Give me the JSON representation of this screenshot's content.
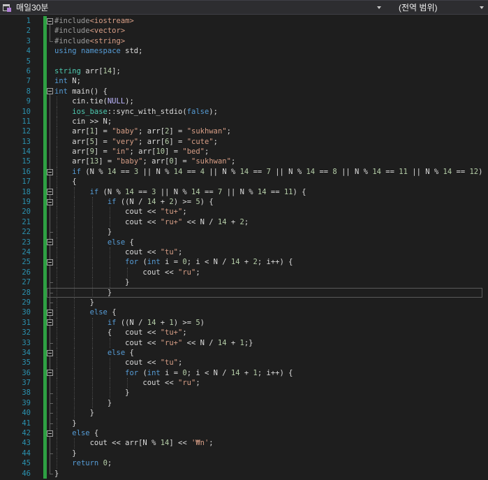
{
  "navbar": {
    "project": "매일30분",
    "scope": "(전역 범위)"
  },
  "colors": {
    "background": "#1E1E1E",
    "navbar_background": "#2D2D30",
    "line_number": "#2B91AF",
    "keyword": "#569CD6",
    "string": "#D69D85",
    "number": "#B5CEA8",
    "type": "#4EC9B0",
    "preprocessor": "#9B9B9B",
    "macro": "#BEB7FF",
    "plain_text": "#DCDCDC",
    "change_tracking": "#2EA043"
  },
  "code": {
    "language": "cpp",
    "current_line": 28,
    "lines": [
      {
        "n": 1,
        "m": "b",
        "g": [],
        "t": [
          [
            "pp",
            "#include"
          ],
          [
            "str",
            "<iostream>"
          ]
        ]
      },
      {
        "n": 2,
        "m": "l",
        "g": [],
        "t": [
          [
            "pp",
            "#include"
          ],
          [
            "str",
            "<vector>"
          ]
        ]
      },
      {
        "n": 3,
        "m": "c",
        "g": [],
        "t": [
          [
            "pp",
            "#include"
          ],
          [
            "str",
            "<string>"
          ]
        ]
      },
      {
        "n": 4,
        "m": "",
        "g": [],
        "t": [
          [
            "kw",
            "using"
          ],
          [
            "pl",
            " "
          ],
          [
            "kw",
            "namespace"
          ],
          [
            "pl",
            " std;"
          ]
        ]
      },
      {
        "n": 5,
        "m": "",
        "g": [],
        "t": []
      },
      {
        "n": 6,
        "m": "",
        "g": [],
        "t": [
          [
            "ty",
            "string"
          ],
          [
            "pl",
            " arr["
          ],
          [
            "num",
            "14"
          ],
          [
            "pl",
            "];"
          ]
        ]
      },
      {
        "n": 7,
        "m": "",
        "g": [],
        "t": [
          [
            "kw",
            "int"
          ],
          [
            "pl",
            " N;"
          ]
        ]
      },
      {
        "n": 8,
        "m": "b",
        "g": [],
        "t": [
          [
            "kw",
            "int"
          ],
          [
            "pl",
            " main() {"
          ]
        ]
      },
      {
        "n": 9,
        "m": "l",
        "g": [
          0
        ],
        "t": [
          [
            "pl",
            "    cin.tie("
          ],
          [
            "mac",
            "NULL"
          ],
          [
            "pl",
            ");"
          ]
        ]
      },
      {
        "n": 10,
        "m": "l",
        "g": [
          0
        ],
        "t": [
          [
            "pl",
            "    "
          ],
          [
            "ty",
            "ios_base"
          ],
          [
            "pl",
            "::sync_with_stdio("
          ],
          [
            "kw",
            "false"
          ],
          [
            "pl",
            ");"
          ]
        ]
      },
      {
        "n": 11,
        "m": "l",
        "g": [
          0
        ],
        "t": [
          [
            "pl",
            "    cin >> N;"
          ]
        ]
      },
      {
        "n": 12,
        "m": "l",
        "g": [
          0
        ],
        "t": [
          [
            "pl",
            "    arr["
          ],
          [
            "num",
            "1"
          ],
          [
            "pl",
            "] = "
          ],
          [
            "str",
            "\"baby\""
          ],
          [
            "pl",
            "; arr["
          ],
          [
            "num",
            "2"
          ],
          [
            "pl",
            "] = "
          ],
          [
            "str",
            "\"sukhwan\""
          ],
          [
            "pl",
            ";"
          ]
        ]
      },
      {
        "n": 13,
        "m": "l",
        "g": [
          0
        ],
        "t": [
          [
            "pl",
            "    arr["
          ],
          [
            "num",
            "5"
          ],
          [
            "pl",
            "] = "
          ],
          [
            "str",
            "\"very\""
          ],
          [
            "pl",
            "; arr["
          ],
          [
            "num",
            "6"
          ],
          [
            "pl",
            "] = "
          ],
          [
            "str",
            "\"cute\""
          ],
          [
            "pl",
            ";"
          ]
        ]
      },
      {
        "n": 14,
        "m": "l",
        "g": [
          0
        ],
        "t": [
          [
            "pl",
            "    arr["
          ],
          [
            "num",
            "9"
          ],
          [
            "pl",
            "] = "
          ],
          [
            "str",
            "\"in\""
          ],
          [
            "pl",
            "; arr["
          ],
          [
            "num",
            "10"
          ],
          [
            "pl",
            "] = "
          ],
          [
            "str",
            "\"bed\""
          ],
          [
            "pl",
            ";"
          ]
        ]
      },
      {
        "n": 15,
        "m": "l",
        "g": [
          0
        ],
        "t": [
          [
            "pl",
            "    arr["
          ],
          [
            "num",
            "13"
          ],
          [
            "pl",
            "] = "
          ],
          [
            "str",
            "\"baby\""
          ],
          [
            "pl",
            "; arr["
          ],
          [
            "num",
            "0"
          ],
          [
            "pl",
            "] = "
          ],
          [
            "str",
            "\"sukhwan\""
          ],
          [
            "pl",
            ";"
          ]
        ]
      },
      {
        "n": 16,
        "m": "bl",
        "g": [
          0
        ],
        "t": [
          [
            "pl",
            "    "
          ],
          [
            "kw",
            "if"
          ],
          [
            "pl",
            " (N % "
          ],
          [
            "num",
            "14"
          ],
          [
            "pl",
            " == "
          ],
          [
            "num",
            "3"
          ],
          [
            "pl",
            " || N % "
          ],
          [
            "num",
            "14"
          ],
          [
            "pl",
            " == "
          ],
          [
            "num",
            "4"
          ],
          [
            "pl",
            " || N % "
          ],
          [
            "num",
            "14"
          ],
          [
            "pl",
            " == "
          ],
          [
            "num",
            "7"
          ],
          [
            "pl",
            " || N % "
          ],
          [
            "num",
            "14"
          ],
          [
            "pl",
            " == "
          ],
          [
            "num",
            "8"
          ],
          [
            "pl",
            " || N % "
          ],
          [
            "num",
            "14"
          ],
          [
            "pl",
            " == "
          ],
          [
            "num",
            "11"
          ],
          [
            "pl",
            " || N % "
          ],
          [
            "num",
            "14"
          ],
          [
            "pl",
            " == "
          ],
          [
            "num",
            "12"
          ],
          [
            "pl",
            ")"
          ]
        ]
      },
      {
        "n": 17,
        "m": "l",
        "g": [
          0
        ],
        "t": [
          [
            "pl",
            "    {"
          ]
        ]
      },
      {
        "n": 18,
        "m": "bl",
        "g": [
          0,
          4
        ],
        "t": [
          [
            "pl",
            "        "
          ],
          [
            "kw",
            "if"
          ],
          [
            "pl",
            " (N % "
          ],
          [
            "num",
            "14"
          ],
          [
            "pl",
            " == "
          ],
          [
            "num",
            "3"
          ],
          [
            "pl",
            " || N % "
          ],
          [
            "num",
            "14"
          ],
          [
            "pl",
            " == "
          ],
          [
            "num",
            "7"
          ],
          [
            "pl",
            " || N % "
          ],
          [
            "num",
            "14"
          ],
          [
            "pl",
            " == "
          ],
          [
            "num",
            "11"
          ],
          [
            "pl",
            ") {"
          ]
        ]
      },
      {
        "n": 19,
        "m": "bl",
        "g": [
          0,
          4,
          8
        ],
        "t": [
          [
            "pl",
            "            "
          ],
          [
            "kw",
            "if"
          ],
          [
            "pl",
            " ((N / "
          ],
          [
            "num",
            "14"
          ],
          [
            "pl",
            " + "
          ],
          [
            "num",
            "2"
          ],
          [
            "pl",
            ") >= "
          ],
          [
            "num",
            "5"
          ],
          [
            "pl",
            ") {"
          ]
        ]
      },
      {
        "n": 20,
        "m": "l",
        "g": [
          0,
          4,
          8,
          12
        ],
        "t": [
          [
            "pl",
            "                cout << "
          ],
          [
            "str",
            "\"tu+\""
          ],
          [
            "pl",
            ";"
          ]
        ]
      },
      {
        "n": 21,
        "m": "l",
        "g": [
          0,
          4,
          8,
          12
        ],
        "t": [
          [
            "pl",
            "                cout << "
          ],
          [
            "str",
            "\"ru+\""
          ],
          [
            "pl",
            " << N / "
          ],
          [
            "num",
            "14"
          ],
          [
            "pl",
            " + "
          ],
          [
            "num",
            "2"
          ],
          [
            "pl",
            ";"
          ]
        ]
      },
      {
        "n": 22,
        "m": "e",
        "g": [
          0,
          4,
          8
        ],
        "t": [
          [
            "pl",
            "            }"
          ]
        ]
      },
      {
        "n": 23,
        "m": "bl",
        "g": [
          0,
          4,
          8
        ],
        "t": [
          [
            "pl",
            "            "
          ],
          [
            "kw",
            "else"
          ],
          [
            "pl",
            " {"
          ]
        ]
      },
      {
        "n": 24,
        "m": "l",
        "g": [
          0,
          4,
          8,
          12
        ],
        "t": [
          [
            "pl",
            "                cout << "
          ],
          [
            "str",
            "\"tu\""
          ],
          [
            "pl",
            ";"
          ]
        ]
      },
      {
        "n": 25,
        "m": "bl",
        "g": [
          0,
          4,
          8,
          12
        ],
        "t": [
          [
            "pl",
            "                "
          ],
          [
            "kw",
            "for"
          ],
          [
            "pl",
            " ("
          ],
          [
            "kw",
            "int"
          ],
          [
            "pl",
            " i = "
          ],
          [
            "num",
            "0"
          ],
          [
            "pl",
            "; i < N / "
          ],
          [
            "num",
            "14"
          ],
          [
            "pl",
            " + "
          ],
          [
            "num",
            "2"
          ],
          [
            "pl",
            "; i++) {"
          ]
        ]
      },
      {
        "n": 26,
        "m": "l",
        "g": [
          0,
          4,
          8,
          12,
          16
        ],
        "t": [
          [
            "pl",
            "                    cout << "
          ],
          [
            "str",
            "\"ru\""
          ],
          [
            "pl",
            ";"
          ]
        ]
      },
      {
        "n": 27,
        "m": "e",
        "g": [
          0,
          4,
          8,
          12
        ],
        "t": [
          [
            "pl",
            "                }"
          ]
        ]
      },
      {
        "n": 28,
        "m": "e",
        "g": [
          0,
          4,
          8
        ],
        "cur": true,
        "t": [
          [
            "pl",
            "            }"
          ]
        ]
      },
      {
        "n": 29,
        "m": "e",
        "g": [
          0,
          4
        ],
        "t": [
          [
            "pl",
            "        }"
          ]
        ]
      },
      {
        "n": 30,
        "m": "bl",
        "g": [
          0,
          4
        ],
        "t": [
          [
            "pl",
            "        "
          ],
          [
            "kw",
            "else"
          ],
          [
            "pl",
            " {"
          ]
        ]
      },
      {
        "n": 31,
        "m": "bl",
        "g": [
          0,
          4,
          8
        ],
        "t": [
          [
            "pl",
            "            "
          ],
          [
            "kw",
            "if"
          ],
          [
            "pl",
            " ((N / "
          ],
          [
            "num",
            "14"
          ],
          [
            "pl",
            " + "
          ],
          [
            "num",
            "1"
          ],
          [
            "pl",
            ") >= "
          ],
          [
            "num",
            "5"
          ],
          [
            "pl",
            ")"
          ]
        ]
      },
      {
        "n": 32,
        "m": "l",
        "g": [
          0,
          4,
          8
        ],
        "t": [
          [
            "pl",
            "            {   cout << "
          ],
          [
            "str",
            "\"tu+\""
          ],
          [
            "pl",
            ";"
          ]
        ]
      },
      {
        "n": 33,
        "m": "e",
        "g": [
          0,
          4,
          8,
          12
        ],
        "t": [
          [
            "pl",
            "                cout << "
          ],
          [
            "str",
            "\"ru+\""
          ],
          [
            "pl",
            " << N / "
          ],
          [
            "num",
            "14"
          ],
          [
            "pl",
            " + "
          ],
          [
            "num",
            "1"
          ],
          [
            "pl",
            ";}"
          ]
        ]
      },
      {
        "n": 34,
        "m": "bl",
        "g": [
          0,
          4,
          8
        ],
        "t": [
          [
            "pl",
            "            "
          ],
          [
            "kw",
            "else"
          ],
          [
            "pl",
            " {"
          ]
        ]
      },
      {
        "n": 35,
        "m": "l",
        "g": [
          0,
          4,
          8,
          12
        ],
        "t": [
          [
            "pl",
            "                cout << "
          ],
          [
            "str",
            "\"tu\""
          ],
          [
            "pl",
            ";"
          ]
        ]
      },
      {
        "n": 36,
        "m": "bl",
        "g": [
          0,
          4,
          8,
          12
        ],
        "t": [
          [
            "pl",
            "                "
          ],
          [
            "kw",
            "for"
          ],
          [
            "pl",
            " ("
          ],
          [
            "kw",
            "int"
          ],
          [
            "pl",
            " i = "
          ],
          [
            "num",
            "0"
          ],
          [
            "pl",
            "; i < N / "
          ],
          [
            "num",
            "14"
          ],
          [
            "pl",
            " + "
          ],
          [
            "num",
            "1"
          ],
          [
            "pl",
            "; i++) {"
          ]
        ]
      },
      {
        "n": 37,
        "m": "l",
        "g": [
          0,
          4,
          8,
          12,
          16
        ],
        "t": [
          [
            "pl",
            "                    cout << "
          ],
          [
            "str",
            "\"ru\""
          ],
          [
            "pl",
            ";"
          ]
        ]
      },
      {
        "n": 38,
        "m": "e",
        "g": [
          0,
          4,
          8,
          12
        ],
        "t": [
          [
            "pl",
            "                }"
          ]
        ]
      },
      {
        "n": 39,
        "m": "e",
        "g": [
          0,
          4,
          8
        ],
        "t": [
          [
            "pl",
            "            }"
          ]
        ]
      },
      {
        "n": 40,
        "m": "e",
        "g": [
          0,
          4
        ],
        "t": [
          [
            "pl",
            "        }"
          ]
        ]
      },
      {
        "n": 41,
        "m": "e",
        "g": [
          0
        ],
        "t": [
          [
            "pl",
            "    }"
          ]
        ]
      },
      {
        "n": 42,
        "m": "bl",
        "g": [
          0
        ],
        "t": [
          [
            "pl",
            "    "
          ],
          [
            "kw",
            "else"
          ],
          [
            "pl",
            " {"
          ]
        ]
      },
      {
        "n": 43,
        "m": "l",
        "g": [
          0,
          4
        ],
        "t": [
          [
            "pl",
            "        cout << arr[N % "
          ],
          [
            "num",
            "14"
          ],
          [
            "pl",
            "] << "
          ],
          [
            "str",
            "'₩n'"
          ],
          [
            "pl",
            ";"
          ]
        ]
      },
      {
        "n": 44,
        "m": "e",
        "g": [
          0
        ],
        "t": [
          [
            "pl",
            "    }"
          ]
        ]
      },
      {
        "n": 45,
        "m": "l",
        "g": [
          0
        ],
        "t": [
          [
            "pl",
            "    "
          ],
          [
            "kw",
            "return"
          ],
          [
            "pl",
            " "
          ],
          [
            "num",
            "0"
          ],
          [
            "pl",
            ";"
          ]
        ]
      },
      {
        "n": 46,
        "m": "c",
        "g": [],
        "t": [
          [
            "pl",
            "}"
          ]
        ]
      }
    ]
  }
}
